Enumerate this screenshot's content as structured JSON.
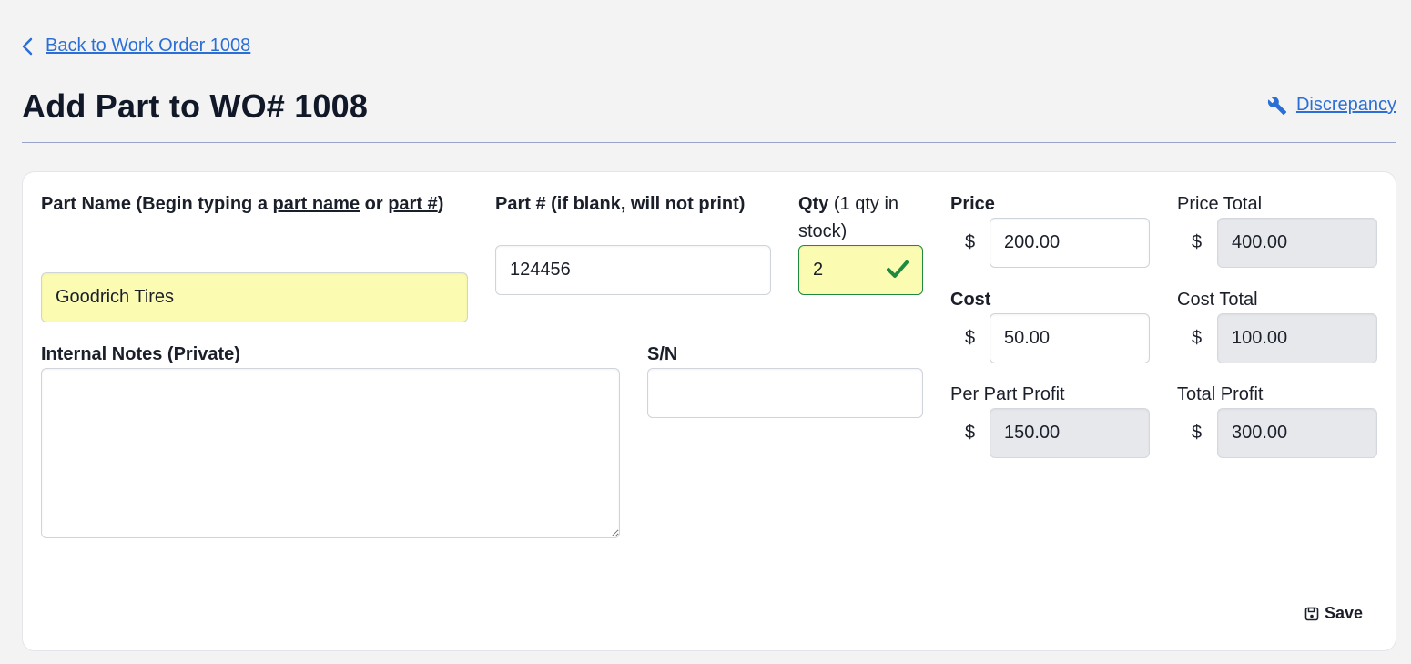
{
  "nav": {
    "back_label": "Back to Work Order 1008"
  },
  "header": {
    "title": "Add Part to WO# 1008",
    "discrepancy_label": "Discrepancy"
  },
  "form": {
    "part_name": {
      "label_prefix": "Part Name (Begin typing a ",
      "label_link1": "part name",
      "label_mid": " or ",
      "label_link2": "part #",
      "label_suffix": ")",
      "value": "Goodrich Tires"
    },
    "part_number": {
      "label": "Part # (if blank, will not print)",
      "value": "124456"
    },
    "qty": {
      "label": "Qty",
      "label_note": " (1 qty in stock)",
      "value": "2"
    },
    "internal_notes": {
      "label": "Internal Notes (Private)",
      "value": ""
    },
    "serial_number": {
      "label": "S/N",
      "value": ""
    },
    "price": {
      "label": "Price",
      "currency": "$",
      "value": "200.00"
    },
    "price_total": {
      "label": "Price Total",
      "currency": "$",
      "value": "400.00"
    },
    "cost": {
      "label": "Cost",
      "currency": "$",
      "value": "50.00"
    },
    "cost_total": {
      "label": "Cost Total",
      "currency": "$",
      "value": "100.00"
    },
    "per_part_profit": {
      "label": "Per Part Profit",
      "currency": "$",
      "value": "150.00"
    },
    "total_profit": {
      "label": "Total Profit",
      "currency": "$",
      "value": "300.00"
    },
    "save_label": "Save"
  },
  "colors": {
    "link": "#2b6fd6",
    "highlight": "#fbfbb2",
    "valid": "#1f8a3f",
    "readonly": "#e6e8ec"
  },
  "icons": [
    "chevron-left-icon",
    "wrench-icon",
    "check-icon",
    "save-icon"
  ]
}
